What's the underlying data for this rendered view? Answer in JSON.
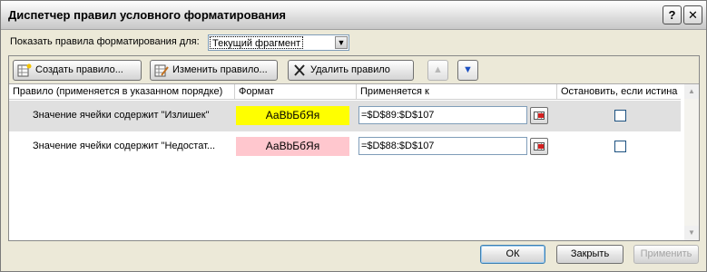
{
  "window": {
    "title": "Диспетчер правил условного форматирования",
    "help_label": "?",
    "close_label": "✕"
  },
  "show_rules": {
    "label": "Показать правила форматирования для:",
    "selected": "Текущий фрагмент"
  },
  "toolbar": {
    "create_label": "Создать правило...",
    "edit_label": "Изменить правило...",
    "delete_label": "Удалить правило",
    "move_up_icon": "arrow-up-icon",
    "move_down_icon": "arrow-down-icon"
  },
  "table": {
    "columns": [
      "Правило (применяется в указанном порядке)",
      "Формат",
      "Применяется к",
      "Остановить, если истина"
    ],
    "rows": [
      {
        "rule": "Значение ячейки содержит \"Излишек\"",
        "format_preview": "АаВbБбЯя",
        "format_bg": "#ffff00",
        "applies_to": "=$D$89:$D$107",
        "stop_if_true": false
      },
      {
        "rule": "Значение ячейки содержит \"Недостат...",
        "format_preview": "АаВbБбЯя",
        "format_bg": "#ffc7ce",
        "applies_to": "=$D$88:$D$107",
        "stop_if_true": false
      }
    ]
  },
  "footer": {
    "ok_label": "ОК",
    "close_label": "Закрыть",
    "apply_label": "Применить"
  },
  "colors": {
    "dialog_bg": "#ece9d8",
    "selected_row": "#e0e0e0",
    "format_yellow": "#ffff00",
    "format_pink": "#ffc7ce"
  }
}
